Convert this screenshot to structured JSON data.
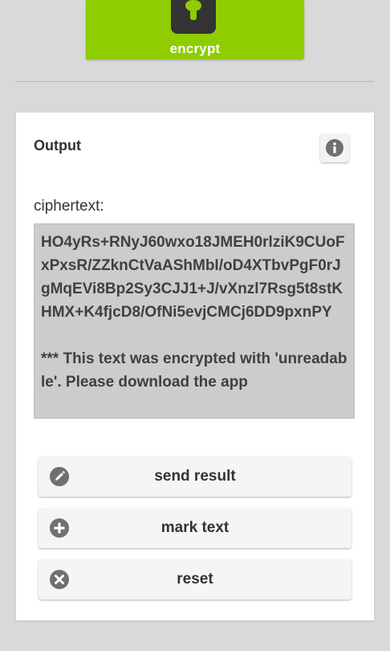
{
  "header": {
    "encrypt_label": "encrypt",
    "accent_color": "#8fcc00"
  },
  "output": {
    "title": "Output",
    "info_icon": "info-icon",
    "ciphertext_label": "ciphertext:",
    "ciphertext": "HO4yRs+RNyJ60wxo18JMEH0rlziK9CUoFxPxsR/ZZknCtVaAShMbI/oD4XTbvPgF0rJgMqEVi8Bp2Sy3CJJ1+J/vXnzl7Rsg5t8stKHMX+K4fjcD8/OfNi5evjCMCj6DD9pxnPY\n\n*** This text was encrypted with 'unreadable'. Please download the app"
  },
  "actions": [
    {
      "label": "send result",
      "icon": "pencil-icon"
    },
    {
      "label": "mark text",
      "icon": "plus-icon"
    },
    {
      "label": "reset",
      "icon": "close-icon"
    }
  ]
}
